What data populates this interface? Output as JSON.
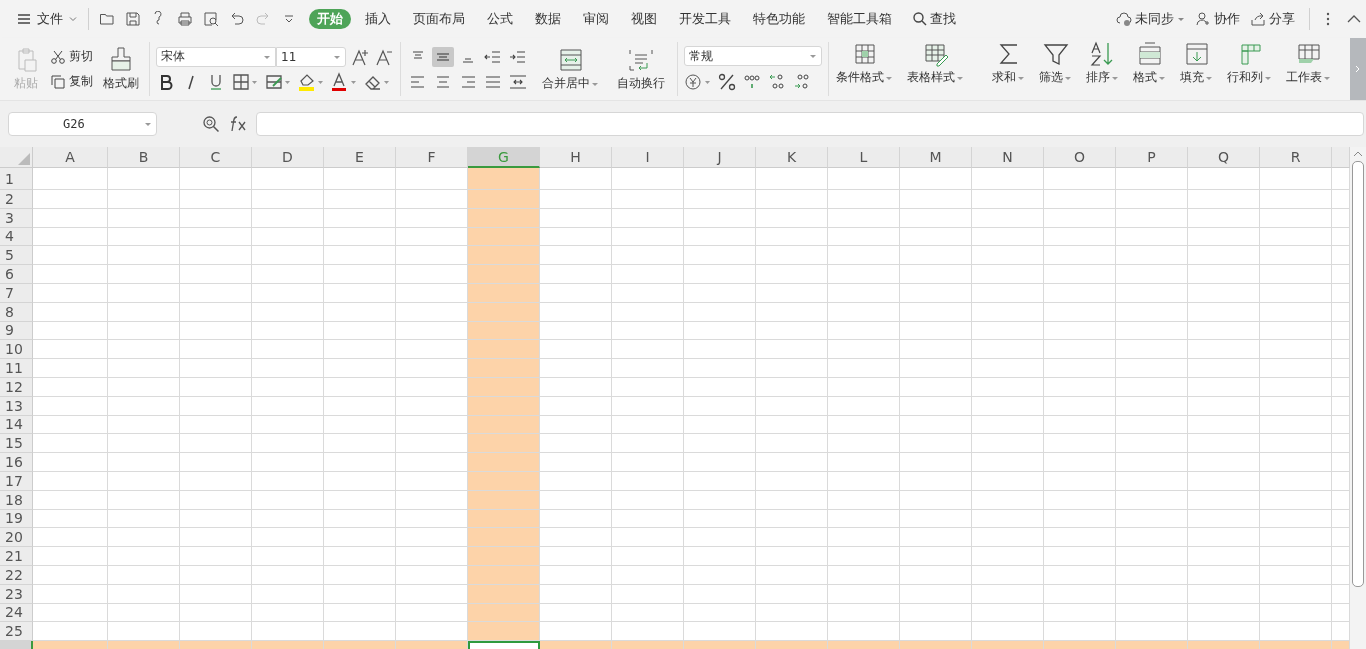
{
  "menu": {
    "file": "文件",
    "tabs": [
      {
        "label": "开始",
        "selected": true
      },
      {
        "label": "插入",
        "selected": false
      },
      {
        "label": "页面布局",
        "selected": false
      },
      {
        "label": "公式",
        "selected": false
      },
      {
        "label": "数据",
        "selected": false
      },
      {
        "label": "审阅",
        "selected": false
      },
      {
        "label": "视图",
        "selected": false
      },
      {
        "label": "开发工具",
        "selected": false
      },
      {
        "label": "特色功能",
        "selected": false
      },
      {
        "label": "智能工具箱",
        "selected": false
      }
    ],
    "search": "查找",
    "sync": "未同步",
    "collaborate": "协作",
    "share": "分享"
  },
  "ribbon": {
    "paste": {
      "label": "粘贴",
      "disabled": true
    },
    "cut": "剪切",
    "copy": "复制",
    "format_painter": "格式刷",
    "font_name": "宋体",
    "font_size": "11",
    "align": [
      {
        "kind": "top",
        "selected": false
      },
      {
        "kind": "middle",
        "selected": true
      },
      {
        "kind": "bottom",
        "selected": false
      },
      {
        "kind": "outdent",
        "selected": false
      },
      {
        "kind": "indent",
        "selected": false
      },
      {
        "kind": "left",
        "selected": false
      },
      {
        "kind": "center",
        "selected": false
      },
      {
        "kind": "right",
        "selected": false
      },
      {
        "kind": "justify",
        "selected": false
      },
      {
        "kind": "distributed",
        "selected": false
      }
    ],
    "merge": "合并居中",
    "wrap": "自动换行",
    "number_format": "常规",
    "tools": [
      {
        "kind": "conditional",
        "label": "条件格式"
      },
      {
        "kind": "table-style",
        "label": "表格样式"
      },
      {
        "kind": "sum",
        "label": "求和"
      },
      {
        "kind": "filter",
        "label": "筛选"
      },
      {
        "kind": "sort",
        "label": "排序"
      },
      {
        "kind": "format",
        "label": "格式"
      },
      {
        "kind": "fill",
        "label": "填充"
      },
      {
        "kind": "rowcol",
        "label": "行和列"
      },
      {
        "kind": "sheet",
        "label": "工作表"
      }
    ]
  },
  "formula_bar": {
    "name_box": "G26"
  },
  "sheet": {
    "columns": [
      {
        "label": "A",
        "selected": false
      },
      {
        "label": "B",
        "selected": false
      },
      {
        "label": "C",
        "selected": false
      },
      {
        "label": "D",
        "selected": false
      },
      {
        "label": "E",
        "selected": false
      },
      {
        "label": "F",
        "selected": false
      },
      {
        "label": "G",
        "selected": true
      },
      {
        "label": "H",
        "selected": false
      },
      {
        "label": "I",
        "selected": false
      },
      {
        "label": "J",
        "selected": false
      },
      {
        "label": "K",
        "selected": false
      },
      {
        "label": "L",
        "selected": false
      },
      {
        "label": "M",
        "selected": false
      },
      {
        "label": "N",
        "selected": false
      },
      {
        "label": "O",
        "selected": false
      },
      {
        "label": "P",
        "selected": false
      },
      {
        "label": "Q",
        "selected": false
      },
      {
        "label": "R",
        "selected": false
      }
    ],
    "rows": [
      {
        "label": "1",
        "selected": false
      },
      {
        "label": "2",
        "selected": false
      },
      {
        "label": "3",
        "selected": false
      },
      {
        "label": "4",
        "selected": false
      },
      {
        "label": "5",
        "selected": false
      },
      {
        "label": "6",
        "selected": false
      },
      {
        "label": "7",
        "selected": false
      },
      {
        "label": "8",
        "selected": false
      },
      {
        "label": "9",
        "selected": false
      },
      {
        "label": "10",
        "selected": false
      },
      {
        "label": "11",
        "selected": false
      },
      {
        "label": "12",
        "selected": false
      },
      {
        "label": "13",
        "selected": false
      },
      {
        "label": "14",
        "selected": false
      },
      {
        "label": "15",
        "selected": false
      },
      {
        "label": "16",
        "selected": false
      },
      {
        "label": "17",
        "selected": false
      },
      {
        "label": "18",
        "selected": false
      },
      {
        "label": "19",
        "selected": false
      },
      {
        "label": "20",
        "selected": false
      },
      {
        "label": "21",
        "selected": false
      },
      {
        "label": "22",
        "selected": false
      },
      {
        "label": "23",
        "selected": false
      },
      {
        "label": "24",
        "selected": false
      },
      {
        "label": "25",
        "selected": false
      },
      {
        "selected": true
      }
    ]
  }
}
